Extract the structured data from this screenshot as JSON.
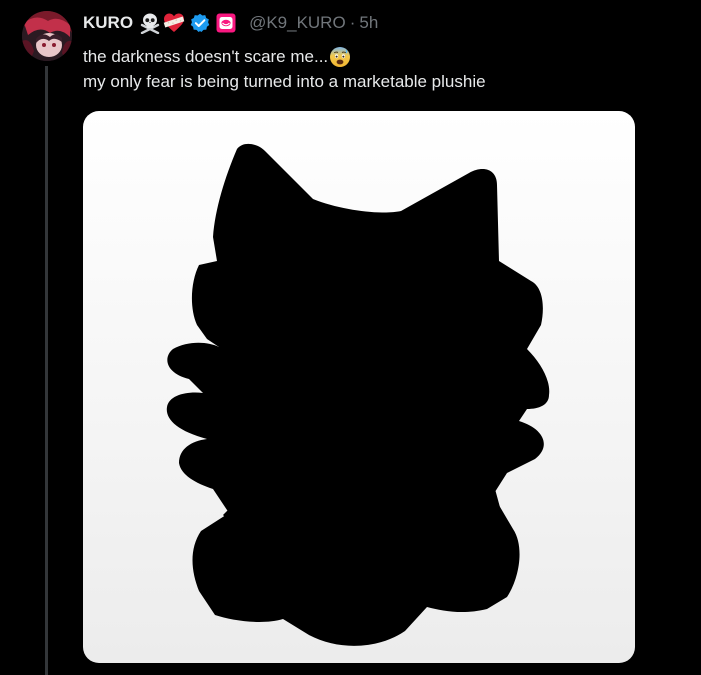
{
  "tweet": {
    "display_name": "KURO",
    "name_emojis": [
      "skull-crossbones-emoji",
      "bandaged-heart-emoji"
    ],
    "verified_icon": "verified-badge-icon",
    "affiliate_icon": "affiliate-badge-icon",
    "handle": "@K9_KURO",
    "separator": "·",
    "time": "5h",
    "text_line_1": "the darkness doesn't scare me...",
    "text_line_1_emoji": "anxious-face-emoji",
    "text_line_2": "my only fear is being turned into a marketable plushie",
    "media": {
      "type": "image",
      "description_icon": "plushie-silhouette"
    }
  },
  "colors": {
    "background": "#000000",
    "text": "#e7e9ea",
    "secondary_text": "#71767b",
    "verified": "#1d9bf0",
    "affiliate": "#f91880",
    "thread_line": "#333639"
  }
}
